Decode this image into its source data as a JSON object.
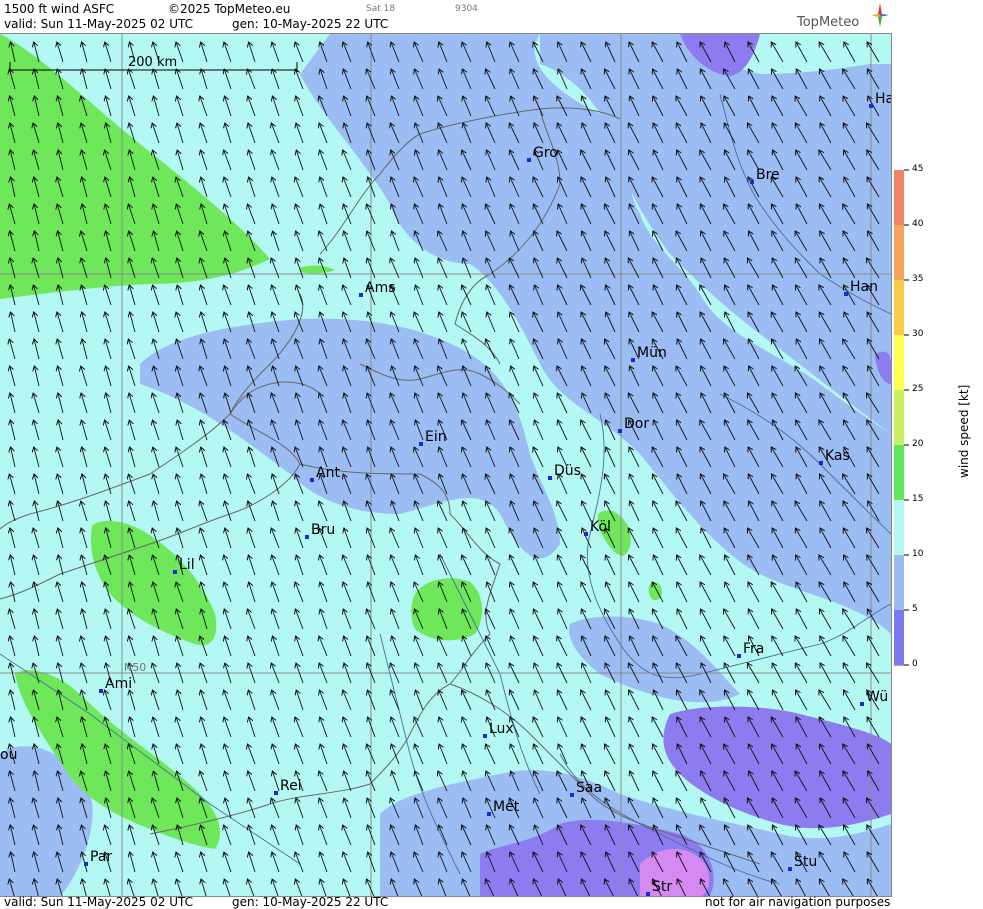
{
  "header": {
    "product": "1500 ft wind ASFC",
    "copyright": "©2025 TopMeteo.eu",
    "day": "Sat 18",
    "code": "9304",
    "valid": "valid:  Sun  11-May-2025  02 UTC",
    "gen": "gen: 10-May-2025 22 UTC",
    "logo": "TopMeteo"
  },
  "footer": {
    "valid": "valid:  Sun  11-May-2025  02 UTC",
    "gen": "gen: 10-May-2025 22 UTC",
    "disclaimer": "not for air navigation purposes"
  },
  "scale_bar": {
    "label": "200 km"
  },
  "grid_label": "N50",
  "legend": {
    "title": "wind  speed  [kt]",
    "ticks": [
      "45",
      "40",
      "35",
      "30",
      "25",
      "20",
      "15",
      "10",
      "5",
      "0"
    ],
    "colors": [
      "#f4826a",
      "#f6a45a",
      "#f8cc48",
      "#ffff50",
      "#c8f060",
      "#5ee85a",
      "#b4f8f4",
      "#9cbcf4",
      "#7c78ee",
      "#d08cf4"
    ]
  },
  "palette": {
    "cyan": "#b4f8f4",
    "blue": "#9cbcf4",
    "green": "#6ee85a",
    "purple": "#8c7cf0",
    "violet": "#d48af0"
  },
  "cities": [
    {
      "id": "ha",
      "name": "Ha"
    },
    {
      "id": "gro",
      "name": "Gro"
    },
    {
      "id": "bre",
      "name": "Bre"
    },
    {
      "id": "ams",
      "name": "Ams"
    },
    {
      "id": "han",
      "name": "Han"
    },
    {
      "id": "mun",
      "name": "Mün"
    },
    {
      "id": "ein",
      "name": "Ein"
    },
    {
      "id": "dor",
      "name": "Dor"
    },
    {
      "id": "ant",
      "name": "Ant"
    },
    {
      "id": "dus",
      "name": "Düs"
    },
    {
      "id": "kas",
      "name": "Kas"
    },
    {
      "id": "bru",
      "name": "Bru"
    },
    {
      "id": "kol",
      "name": "Köl"
    },
    {
      "id": "lil",
      "name": "Lil"
    },
    {
      "id": "fra",
      "name": "Fra"
    },
    {
      "id": "ami",
      "name": "Ami"
    },
    {
      "id": "wu",
      "name": "Wü"
    },
    {
      "id": "lux",
      "name": "Lux"
    },
    {
      "id": "ou",
      "name": "ou"
    },
    {
      "id": "rei",
      "name": "Rei"
    },
    {
      "id": "saa",
      "name": "Saa"
    },
    {
      "id": "met",
      "name": "Met"
    },
    {
      "id": "par",
      "name": "Par"
    },
    {
      "id": "stu",
      "name": "Stu"
    },
    {
      "id": "str",
      "name": "Str"
    }
  ]
}
